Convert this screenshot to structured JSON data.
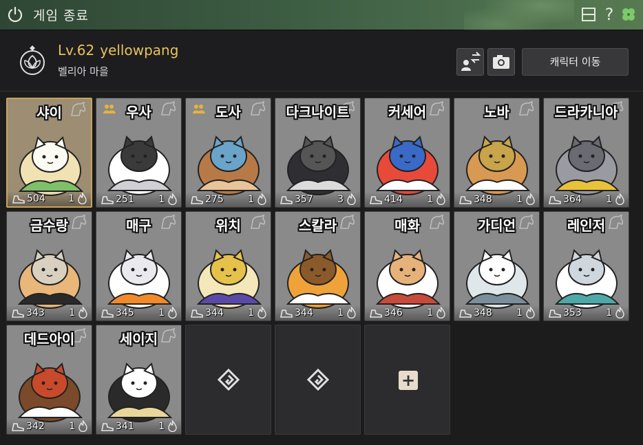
{
  "window": {
    "title": "게임 종료",
    "icons": [
      "power-icon",
      "layout-icon",
      "help-icon",
      "clover-icon"
    ],
    "help_glyph": "?"
  },
  "header": {
    "level": "Lv.62",
    "name": "yellowpang",
    "location": "벨리아 마을",
    "move_button": "캐릭터 이동",
    "icons": [
      "character-swap-icon",
      "camera-icon"
    ]
  },
  "colors": {
    "accent_gold": "#e8c35c",
    "titlebar_green": "#3b5a41",
    "card_grey": "#8a8a8b",
    "selected_border": "#c9a35c"
  },
  "characters": [
    {
      "name": "샤이",
      "level": "504",
      "count": "1",
      "selected": true,
      "party": false,
      "palette": [
        "#f1e2b4",
        "#7fbf6a",
        "#fbfbf4"
      ]
    },
    {
      "name": "우사",
      "level": "251",
      "count": "1",
      "selected": false,
      "party": true,
      "palette": [
        "#ffffff",
        "#cfcfd4",
        "#3a3a3a"
      ]
    },
    {
      "name": "도사",
      "level": "275",
      "count": "1",
      "selected": false,
      "party": true,
      "palette": [
        "#b77a47",
        "#e7c49a",
        "#6aa4c8"
      ]
    },
    {
      "name": "다크나이트",
      "level": "357",
      "count": "3",
      "selected": false,
      "party": false,
      "palette": [
        "#2f2f33",
        "#dcdcdc",
        "#555"
      ]
    },
    {
      "name": "커세어",
      "level": "414",
      "count": "1",
      "selected": false,
      "party": false,
      "palette": [
        "#e84a3a",
        "#ffffff",
        "#3a6ac8"
      ]
    },
    {
      "name": "노바",
      "level": "348",
      "count": "1",
      "selected": false,
      "party": false,
      "palette": [
        "#d89a52",
        "#ffffff",
        "#c8a44a"
      ]
    },
    {
      "name": "드라카니아",
      "level": "364",
      "count": "1",
      "selected": false,
      "party": false,
      "palette": [
        "#9a9aa2",
        "#e9c23a",
        "#6a6a72"
      ]
    },
    {
      "name": "금수랑",
      "level": "343",
      "count": "1",
      "selected": false,
      "party": false,
      "palette": [
        "#e9b77a",
        "#2a2a2a",
        "#d9d0bf"
      ]
    },
    {
      "name": "매구",
      "level": "345",
      "count": "1",
      "selected": false,
      "party": false,
      "palette": [
        "#ffffff",
        "#f08a2a",
        "#e9e9ee"
      ]
    },
    {
      "name": "위치",
      "level": "344",
      "count": "1",
      "selected": false,
      "party": false,
      "palette": [
        "#f4e7b9",
        "#5a4aa8",
        "#e6c24a"
      ]
    },
    {
      "name": "스칼라",
      "level": "344",
      "count": "1",
      "selected": false,
      "party": false,
      "palette": [
        "#f0a23a",
        "#ffffff",
        "#8a5a2a"
      ]
    },
    {
      "name": "매화",
      "level": "346",
      "count": "1",
      "selected": false,
      "party": false,
      "palette": [
        "#ffffff",
        "#c84a3a",
        "#e6b27a"
      ]
    },
    {
      "name": "가디언",
      "level": "348",
      "count": "1",
      "selected": false,
      "party": false,
      "palette": [
        "#dfe7ea",
        "#7a8f99",
        "#ffffff"
      ]
    },
    {
      "name": "레인저",
      "level": "353",
      "count": "1",
      "selected": false,
      "party": false,
      "palette": [
        "#ffffff",
        "#4fa8a8",
        "#cfd7de"
      ]
    },
    {
      "name": "데드아이",
      "level": "342",
      "count": "1",
      "selected": false,
      "party": false,
      "palette": [
        "#7a4a2a",
        "#ffffff",
        "#c84a2a"
      ]
    },
    {
      "name": "세이지",
      "level": "341",
      "count": "1",
      "selected": false,
      "party": false,
      "palette": [
        "#2a2a2a",
        "#e9d79a",
        "#ffffff"
      ]
    }
  ],
  "empty_slots": [
    {
      "type": "locked-slot",
      "icon": "diamond-slot-icon"
    },
    {
      "type": "locked-slot",
      "icon": "diamond-slot-icon"
    },
    {
      "type": "add-slot",
      "icon": "plus-icon",
      "glyph": "+"
    }
  ]
}
